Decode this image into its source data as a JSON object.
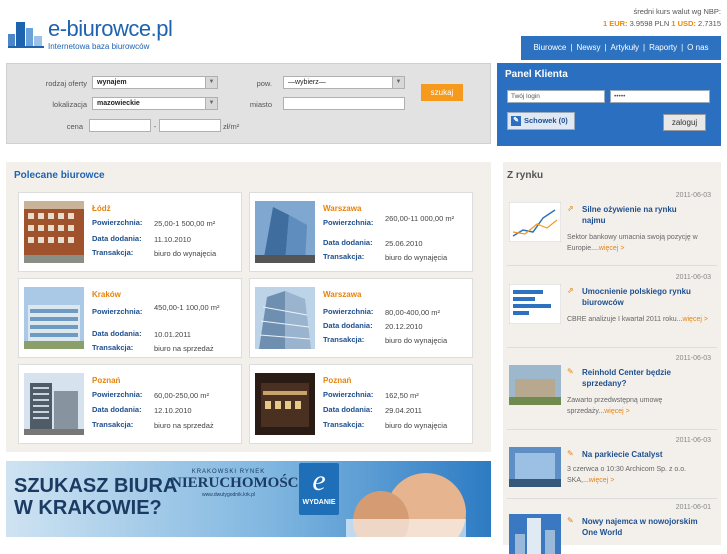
{
  "brand": {
    "name": "e-biurowce.pl",
    "tagline": "Internetowa baza biurowców"
  },
  "rates": {
    "title": "średni kurs walut wg NBP:",
    "eur_label": "1 EUR:",
    "eur_value": "3.9598 PLN",
    "usd_label": "1 USD:",
    "usd_value": "2.7315"
  },
  "topnav": {
    "items": [
      "Biurowce",
      "Newsy",
      "Artykuły",
      "Raporty",
      "O nas"
    ]
  },
  "search": {
    "offer_type_label": "rodzaj oferty",
    "offer_type_value": "wynajem",
    "area_label": "pow.",
    "area_value": "—wybierz—",
    "location_label": "lokalizacja",
    "location_value": "mazowieckie",
    "city_label": "miasto",
    "price_label": "cena",
    "price_sep": "-",
    "price_unit": "zł/m²",
    "submit": "szukaj"
  },
  "panel": {
    "title": "Panel Klienta",
    "login_placeholder": "Twój login",
    "password_placeholder": "•••••",
    "clipboard_label": "Schowek",
    "clipboard_count": "0",
    "login_button": "zaloguj"
  },
  "featured": {
    "title": "Polecane biurowce",
    "labels": {
      "area": "Powierzchnia:",
      "date": "Data dodania:",
      "type": "Transakcja:"
    },
    "items": [
      {
        "city": "Łódź",
        "area": "25,00-1 500,00 m²",
        "date": "11.10.2010",
        "type": "biuro do wynajęcia"
      },
      {
        "city": "Warszawa",
        "area": "260,00-11 000,00 m²",
        "date": "25.06.2010",
        "type": "biuro do wynajęcia"
      },
      {
        "city": "Kraków",
        "area": "450,00-1 100,00 m²",
        "date": "10.01.2011",
        "type": "biuro na sprzedaż"
      },
      {
        "city": "Warszawa",
        "area": "80,00-400,00 m²",
        "date": "20.12.2010",
        "type": "biuro do wynajęcia"
      },
      {
        "city": "Poznań",
        "area": "60,00-250,00 m²",
        "date": "12.10.2010",
        "type": "biuro na sprzedaż"
      },
      {
        "city": "Poznań",
        "area": "162,50 m²",
        "date": "29.04.2011",
        "type": "biuro do wynajęcia"
      }
    ]
  },
  "banner": {
    "headline_1": "SZUKASZ BIURA",
    "headline_2": "W KRAKOWIE?",
    "market_label": "KRAKOWSKI RYNEK",
    "market_title": "NIERUCHOMOŚCI",
    "market_url": "www.dwutygodnik.krk.pl",
    "edition_letter": "e",
    "edition_label": "WYDANIE"
  },
  "market": {
    "title": "Z rynku",
    "more": "więcej >",
    "items": [
      {
        "date": "2011-06-03",
        "title": "Silne ożywienie na rynku najmu",
        "text": "Sektor bankowy umacnia swoją pozycję w Europie...."
      },
      {
        "date": "2011-06-03",
        "title": "Umocnienie polskiego rynku biurowców",
        "text": "CBRE analizuje I kwartał 2011 roku..."
      },
      {
        "date": "2011-06-03",
        "title": "Reinhold Center będzie sprzedany?",
        "text": "Zawarto przedwstępną umowę sprzedaży..."
      },
      {
        "date": "2011-06-03",
        "title": "Na parkiecie Catalyst",
        "text": "3 czerwca o 10:30 Archicom Sp. z o.o. SKA,..."
      },
      {
        "date": "2011-06-01",
        "title": "Nowy najemca w nowojorskim One World",
        "text": ""
      }
    ]
  },
  "colors": {
    "brand_blue": "#1d63b0",
    "accent_orange": "#f08a00",
    "panel_blue": "#2a6fc0"
  }
}
